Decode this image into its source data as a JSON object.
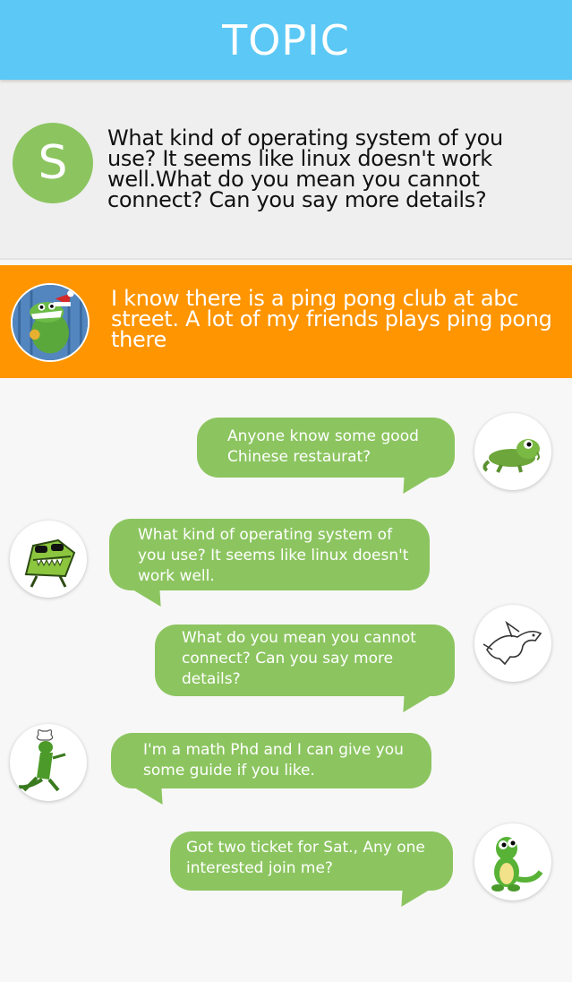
{
  "header": {
    "title": "TOPIC"
  },
  "topic": {
    "avatar_letter": "S",
    "text": "What kind of operating system of you use? It seems like linux doesn't work well.What do you mean you cannot connect? Can you say more details?"
  },
  "featured_reply": {
    "text": "I know there is a ping pong club at abc street. A lot of my friends plays ping pong there"
  },
  "messages": [
    {
      "side": "right",
      "text": "Anyone know some good Chinese restaurat?",
      "avatar": "lizard-avatar-icon"
    },
    {
      "side": "left",
      "text": "What kind of operating system of you use? It seems like linux doesn't work well.",
      "avatar": "crocodile-sunglasses-avatar-icon"
    },
    {
      "side": "right",
      "text": "What do you mean you cannot connect? Can you say more details?",
      "avatar": "dragon-sketch-avatar-icon"
    },
    {
      "side": "left",
      "text": "I'm a math Phd and I can give you some guide if you like.",
      "avatar": "chef-crocodile-avatar-icon"
    },
    {
      "side": "right",
      "text": "Got two ticket for Sat., Any one interested join me?",
      "avatar": "cartoon-crocodile-avatar-icon"
    }
  ],
  "colors": {
    "header": "#5bc8f5",
    "topic_avatar": "#8cc560",
    "reply_card": "#ff9500",
    "bubble": "#8cc560"
  }
}
